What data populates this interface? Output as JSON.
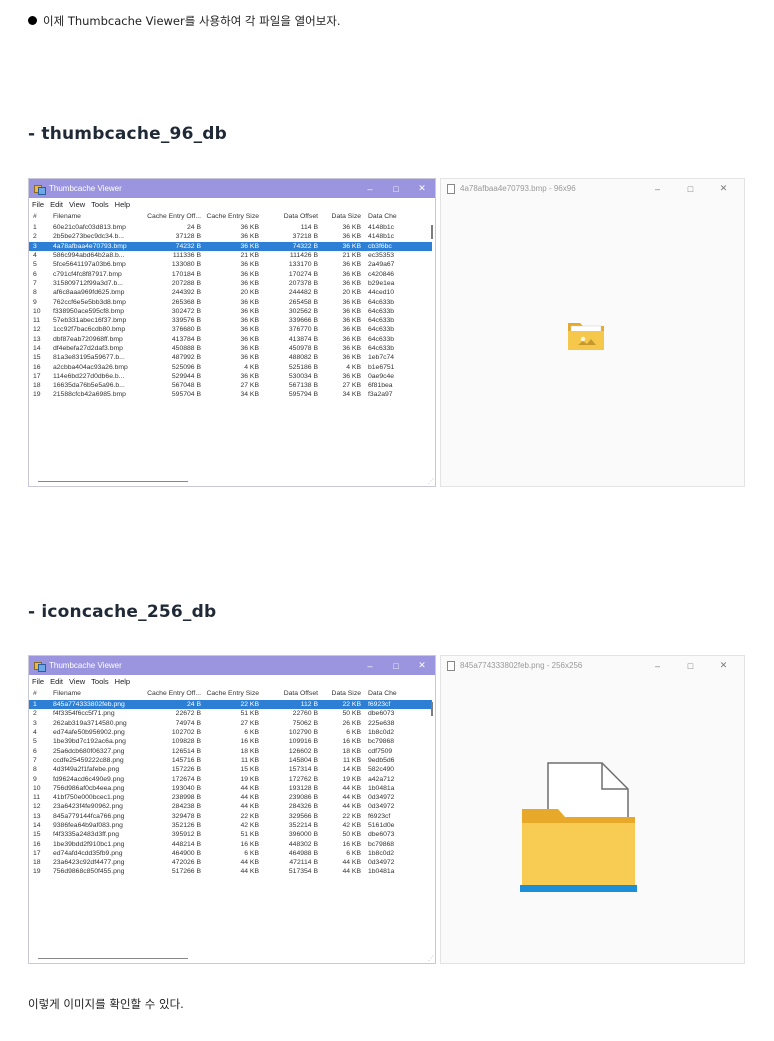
{
  "intro_text": "이제 Thumbcache Viewer를 사용하여 각 파일을 열어보자.",
  "heading1": "- thumbcache_96_db",
  "heading2": "- iconcache_256_db",
  "outro_text": "이렇게 이미지를 확인할 수 있다.",
  "colors": {
    "titlebar": "#9b95e0",
    "selection": "#2d7fd6"
  },
  "viewer": {
    "title": "Thumbcache Viewer",
    "menu": [
      "File",
      "Edit",
      "View",
      "Tools",
      "Help"
    ],
    "columns": [
      "#",
      "Filename",
      "Cache Entry Off...",
      "Cache Entry Size",
      "Data Offset",
      "Data Size",
      "Data Che"
    ],
    "controls": {
      "minimize": "–",
      "maximize": "□",
      "close": "✕"
    }
  },
  "viewer1_rows": [
    [
      "1",
      "60e21c0afc03d813.bmp",
      "24 B",
      "36 KB",
      "114 B",
      "36 KB",
      "4148b1c"
    ],
    [
      "2",
      "2b5be273bec9dc34.b...",
      "37128 B",
      "36 KB",
      "37218 B",
      "36 KB",
      "4148b1c"
    ],
    [
      "3",
      "4a78afbaa4e70793.bmp",
      "74232 B",
      "36 KB",
      "74322 B",
      "36 KB",
      "cb3f6bc"
    ],
    [
      "4",
      "586c994abd64b2a8.b...",
      "111336 B",
      "21 KB",
      "111426 B",
      "21 KB",
      "ec35353"
    ],
    [
      "5",
      "5fce5641197a03b6.bmp",
      "133080 B",
      "36 KB",
      "133170 B",
      "36 KB",
      "2a49a67"
    ],
    [
      "6",
      "c791cf4fc8f87917.bmp",
      "170184 B",
      "36 KB",
      "170274 B",
      "36 KB",
      "c420846"
    ],
    [
      "7",
      "315809712f99a3d7.b...",
      "207288 B",
      "36 KB",
      "207378 B",
      "36 KB",
      "b29e1ea"
    ],
    [
      "8",
      "af6c8aaa969fd625.bmp",
      "244392 B",
      "20 KB",
      "244482 B",
      "20 KB",
      "44ced10"
    ],
    [
      "9",
      "762ccf6e5e5bb3d8.bmp",
      "265368 B",
      "36 KB",
      "265458 B",
      "36 KB",
      "64c633b"
    ],
    [
      "10",
      "f338950ace595cf8.bmp",
      "302472 B",
      "36 KB",
      "302562 B",
      "36 KB",
      "64c633b"
    ],
    [
      "11",
      "57eb331abec16f37.bmp",
      "339576 B",
      "36 KB",
      "339666 B",
      "36 KB",
      "64c633b"
    ],
    [
      "12",
      "1cc92f7bac6cdb80.bmp",
      "376680 B",
      "36 KB",
      "376770 B",
      "36 KB",
      "64c633b"
    ],
    [
      "13",
      "dbf87eab720968ff.bmp",
      "413784 B",
      "36 KB",
      "413874 B",
      "36 KB",
      "64c633b"
    ],
    [
      "14",
      "df4ebefa27d2daf3.bmp",
      "450888 B",
      "36 KB",
      "450978 B",
      "36 KB",
      "64c633b"
    ],
    [
      "15",
      "81a3e83195a59677.b...",
      "487992 B",
      "36 KB",
      "488082 B",
      "36 KB",
      "1eb7c74"
    ],
    [
      "16",
      "a2cbba404ac93a26.bmp",
      "525096 B",
      "4 KB",
      "525186 B",
      "4 KB",
      "b1e6751"
    ],
    [
      "17",
      "114e6bd227d0db6e.b...",
      "529944 B",
      "36 KB",
      "530034 B",
      "36 KB",
      "0ae9c4e"
    ],
    [
      "18",
      "16635da76b5e5a96.b...",
      "567048 B",
      "27 KB",
      "567138 B",
      "27 KB",
      "6f81bea"
    ],
    [
      "19",
      "21588cfcb42a6985.bmp",
      "595704 B",
      "34 KB",
      "595794 B",
      "34 KB",
      "f3a2a97"
    ]
  ],
  "viewer2_rows": [
    [
      "1",
      "845a774333802feb.png",
      "24 B",
      "22 KB",
      "112 B",
      "22 KB",
      "f6923cf"
    ],
    [
      "2",
      "f4f3354f6cc5f71.png",
      "22672 B",
      "51 KB",
      "22760 B",
      "50 KB",
      "dbe6073"
    ],
    [
      "3",
      "262ab319a3714580.png",
      "74974 B",
      "27 KB",
      "75062 B",
      "26 KB",
      "225e638"
    ],
    [
      "4",
      "ed74afe50b956902.png",
      "102702 B",
      "6 KB",
      "102790 B",
      "6 KB",
      "1b8c0d2"
    ],
    [
      "5",
      "1be39bd7c192ac6a.png",
      "109828 B",
      "16 KB",
      "109916 B",
      "16 KB",
      "bc79868"
    ],
    [
      "6",
      "25a6dcb680f06327.png",
      "126514 B",
      "18 KB",
      "126602 B",
      "18 KB",
      "cdf7509"
    ],
    [
      "7",
      "ccdfe25459222c88.png",
      "145716 B",
      "11 KB",
      "145804 B",
      "11 KB",
      "9edb5d6"
    ],
    [
      "8",
      "4d3f49a2f1fafebe.png",
      "157226 B",
      "15 KB",
      "157314 B",
      "14 KB",
      "582c490"
    ],
    [
      "9",
      "fd9624acd6c490e9.png",
      "172674 B",
      "19 KB",
      "172762 B",
      "19 KB",
      "a42a712"
    ],
    [
      "10",
      "756d986af0cb4eea.png",
      "193040 B",
      "44 KB",
      "193128 B",
      "44 KB",
      "1b0481a"
    ],
    [
      "11",
      "41bf750e000bcec1.png",
      "238998 B",
      "44 KB",
      "239086 B",
      "44 KB",
      "0d34972"
    ],
    [
      "12",
      "23a6423f4fe90962.png",
      "284238 B",
      "44 KB",
      "284326 B",
      "44 KB",
      "0d34972"
    ],
    [
      "13",
      "845a779144fca766.png",
      "329478 B",
      "22 KB",
      "329566 B",
      "22 KB",
      "f6923cf"
    ],
    [
      "14",
      "9386fea64b9af083.png",
      "352126 B",
      "42 KB",
      "352214 B",
      "42 KB",
      "5161d0e"
    ],
    [
      "15",
      "f4f3335a2483d3ff.png",
      "395912 B",
      "51 KB",
      "396000 B",
      "50 KB",
      "dbe6073"
    ],
    [
      "16",
      "1be39bdd2f910bc1.png",
      "448214 B",
      "16 KB",
      "448302 B",
      "16 KB",
      "bc79868"
    ],
    [
      "17",
      "ed74afd4cdd35fb9.png",
      "464900 B",
      "6 KB",
      "464988 B",
      "6 KB",
      "1b8c0d2"
    ],
    [
      "18",
      "23a6423c92df4477.png",
      "472026 B",
      "44 KB",
      "472114 B",
      "44 KB",
      "0d34972"
    ],
    [
      "19",
      "756d9868c850f455.png",
      "517266 B",
      "44 KB",
      "517354 B",
      "44 KB",
      "1b0481a"
    ]
  ],
  "selected": {
    "viewer1": 2,
    "viewer2": 0
  },
  "preview1": {
    "title": "4a78afbaa4e70793.bmp - 96x96",
    "icon": "folder-with-images-icon"
  },
  "preview2": {
    "title": "845a774333802feb.png - 256x256",
    "icon": "folder-with-document-icon"
  },
  "preview_controls": {
    "minimize": "–",
    "maximize": "□",
    "close": "✕"
  }
}
